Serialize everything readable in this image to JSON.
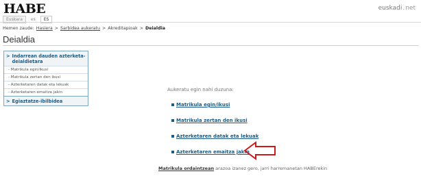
{
  "header": {
    "logo_text": "HABE",
    "lang_tabs": [
      "Euskara",
      "es",
      "ES"
    ],
    "brand": {
      "part1": "euskadi",
      "dot": ".",
      "part2": "net"
    }
  },
  "breadcrumb": {
    "prefix": "Hemen zaude:",
    "items": [
      "Hasiera",
      "Sarbidea aukeratu",
      "Akreditapioak",
      "Deialdia"
    ],
    "separator": ">"
  },
  "page_title": "Deialdia",
  "sidebar": {
    "section1_title": "Indarrean dauden azterketa-deialdietara",
    "items": [
      "- Matrikula egin/ikusi",
      "- Matrikula zertan den ikusi",
      "- Azterketaren datak eta lekuak",
      "- Azterketaren emaitza jakin"
    ],
    "section2_title": "Egiaztatze-ibilbidea",
    "arrow": ">"
  },
  "main": {
    "heading": "Aukeratu egin nahi duzuna:",
    "options": [
      "Matrikula egin/ikusi",
      "Matrikula zertan den ikusi",
      "Azterketaren datak eta lekuak",
      "Azterketaren emaitza jakin"
    ]
  },
  "footnote": {
    "link": "Matrikula ordaintzean",
    "rest": " arazoa izanez gero, jarri harremanetan HABErekin"
  },
  "colors": {
    "link_blue": "#1a5c86",
    "sidebar_border": "#7fa5bf",
    "annotation_red": "#cc1a1a"
  }
}
